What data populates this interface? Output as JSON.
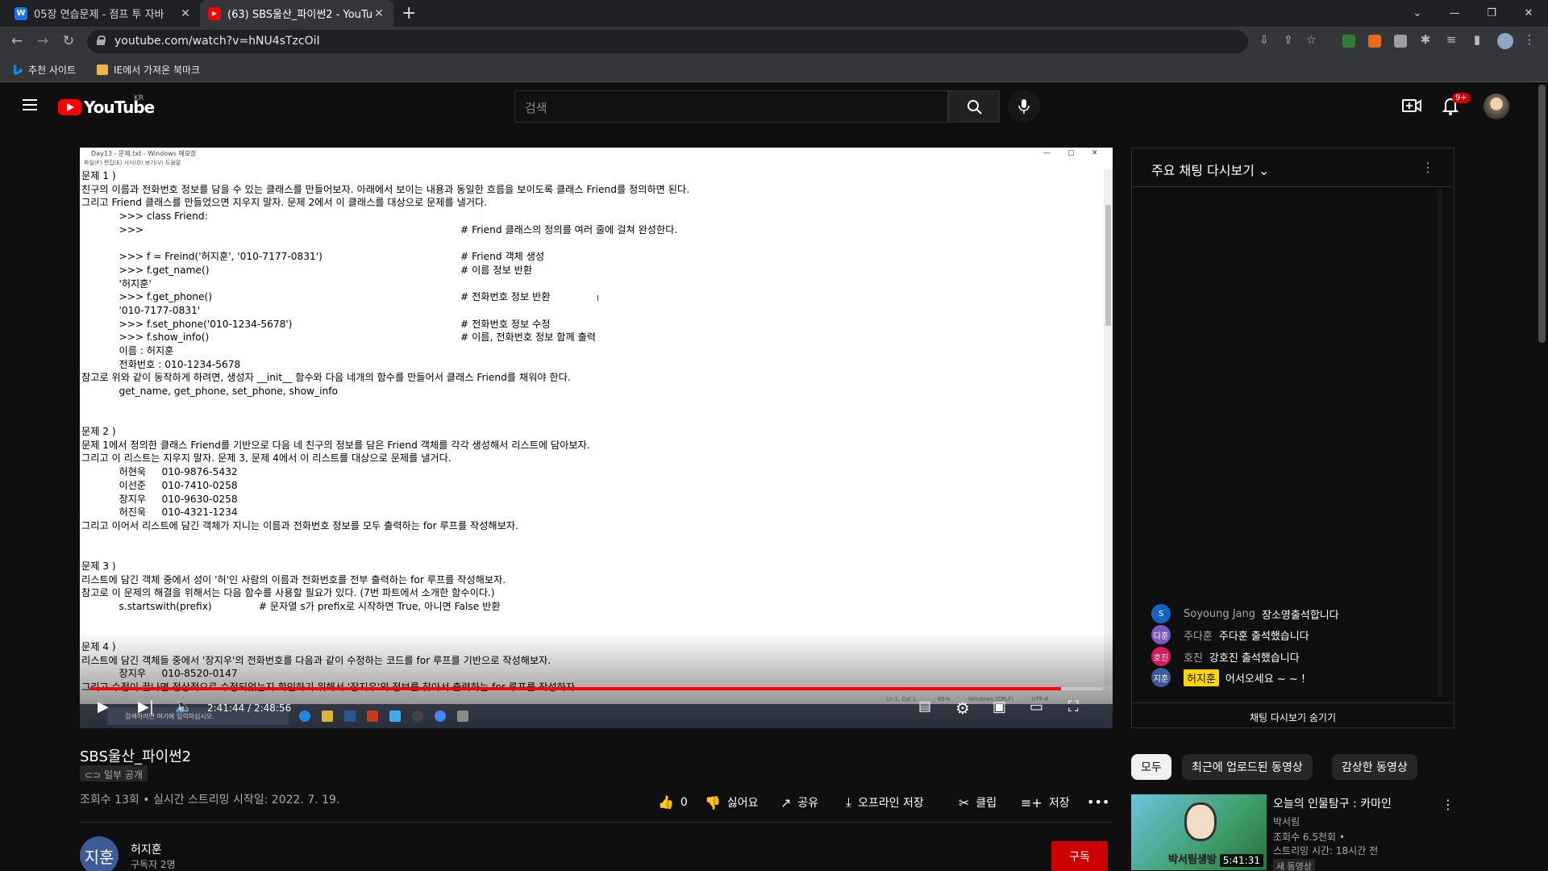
{
  "browser": {
    "tabs": [
      {
        "label": "05장 연습문제 - 점프 투 자바",
        "favicon": "W",
        "color": "#1a73e8"
      },
      {
        "label": "(63) SBS울산_파이썬2 - YouTube",
        "favicon": "▶",
        "color": "#ff0000"
      }
    ],
    "url": "youtube.com/watch?v=hNU4sTzcOiI",
    "bookmarks": [
      "추천 사이트",
      "IE에서 가져온 북마크"
    ]
  },
  "youtube": {
    "region": "KR",
    "search_placeholder": "검색",
    "notification_count": "9+"
  },
  "video": {
    "notepad_title": "Day13 - 문제.txt - Windows 메모장",
    "notepad_menu": "파일(F)   편집(E)   서식(O)   보기(V)   도움말",
    "status_bar": "Ln 1, Col 1            65%          Windows (CRLF)          UTF-8",
    "lines": [
      {
        "t": "문제 1 )",
        "c": ""
      },
      {
        "t": "친구의 이름과 전화번호 정보를 담을 수 있는 클래스를 만들어보자. 아래에서 보이는 내용과 동일한 흐름을 보이도록 클래스 Friend를 정의하면 된다.",
        "c": ""
      },
      {
        "t": "그리고 Friend 클래스를 만들었으면 지우지 말자. 문제 2에서 이 클래스를 대상으로 문제를 낼거다.",
        "c": ""
      },
      {
        "t": "            >>> class Friend:",
        "c": ""
      },
      {
        "t": "            >>>",
        "c": "# Friend 클래스의 정의를 여러 줄에 걸쳐 완성한다."
      },
      {
        "t": "",
        "c": ""
      },
      {
        "t": "            >>> f = Freind('허지훈', '010-7177-0831')",
        "c": "# Friend 객체 생성"
      },
      {
        "t": "            >>> f.get_name()",
        "c": "# 이름 정보 반환"
      },
      {
        "t": "            '허지훈'",
        "c": ""
      },
      {
        "t": "            >>> f.get_phone()",
        "c": "# 전화번호 정보 반환"
      },
      {
        "t": "            '010-7177-0831'",
        "c": ""
      },
      {
        "t": "            >>> f.set_phone('010-1234-5678')",
        "c": "# 전화번호 정보 수정"
      },
      {
        "t": "            >>> f.show_info()",
        "c": "# 이름, 전화번호 정보 함께 출력"
      },
      {
        "t": "            이름 : 허지훈",
        "c": ""
      },
      {
        "t": "            전화번호 : 010-1234-5678",
        "c": ""
      },
      {
        "t": "참고로 위와 같이 동작하게 하려면, 생성자 __init__ 함수와 다음 네개의 함수를 만들어서 클래스 Friend를 채워야 한다.",
        "c": ""
      },
      {
        "t": "            get_name, get_phone, set_phone, show_info",
        "c": ""
      },
      {
        "t": "",
        "c": ""
      },
      {
        "t": "",
        "c": ""
      },
      {
        "t": "문제 2 )",
        "c": ""
      },
      {
        "t": "문제 1에서 정의한 클래스 Friend를 기반으로 다음 네 친구의 정보를 담은 Friend 객체를 각각 생성해서 리스트에 담아보자.",
        "c": ""
      },
      {
        "t": "그리고 이 리스트는 지우지 말자. 문제 3, 문제 4에서 이 리스트를 대상으로 문제를 낼거다.",
        "c": ""
      },
      {
        "t": "            허현욱     010-9876-5432",
        "c": ""
      },
      {
        "t": "            이선준     010-7410-0258",
        "c": ""
      },
      {
        "t": "            장지우     010-9630-0258",
        "c": ""
      },
      {
        "t": "            허진욱     010-4321-1234",
        "c": ""
      },
      {
        "t": "그리고 이어서 리스트에 담긴 객체가 지니는 이름과 전화번호 정보를 모두 출력하는 for 루프를 작성해보자.",
        "c": ""
      },
      {
        "t": "",
        "c": ""
      },
      {
        "t": "",
        "c": ""
      },
      {
        "t": "문제 3 )",
        "c": ""
      },
      {
        "t": "리스트에 담긴 객체 중에서 성이 '허'인 사람의 이름과 전화번호를 전부 출력하는 for 루프를 작성해보자.",
        "c": ""
      },
      {
        "t": "참고로 이 문제의 해결을 위해서는 다음 함수를 사용할 필요가 있다. (7번 파트에서 소개한 함수이다.)",
        "c": ""
      },
      {
        "t": "            s.startswith(prefix)               # 문자열 s가 prefix로 시작하면 True, 아니면 False 반환",
        "c": ""
      },
      {
        "t": "",
        "c": ""
      },
      {
        "t": "",
        "c": ""
      },
      {
        "t": "문제 4 )",
        "c": ""
      },
      {
        "t": "리스트에 담긴 객체들 중에서 '장지우'의 전화번호를 다음과 같이 수정하는 코드를 for 루프를 기반으로 작성해보자.",
        "c": ""
      },
      {
        "t": "            장지우     010-8520-0147",
        "c": ""
      },
      {
        "t": "그리고 수정이 끝나면 정상적으로 수정되었는지 확인하기 위해서 '장지우'의 정보를 찾아서 출력하는 for 루프를 작성하자.",
        "c": ""
      }
    ],
    "taskbar_search": "검색하려면 여기에 입력하십시오.",
    "current_time": "2:41:44",
    "duration": "2:48:56",
    "progress": 0.9587,
    "title": "SBS울산_파이썬2",
    "visibility": "일부 공개",
    "meta": "조회수 13회 • 실시간 스트리밍 시작일: 2022. 7. 19.",
    "actions": {
      "like_count": "0",
      "dislike": "싫어요",
      "share": "공유",
      "offline": "오프라인 저장",
      "clip": "클립",
      "save": "저장"
    },
    "channel": {
      "avatar_text": "지훈",
      "name": "허지훈",
      "subs": "구독자 2명",
      "subscribe": "구독"
    }
  },
  "chat": {
    "title": "주요 채팅 다시보기",
    "messages": [
      {
        "avatar": "S",
        "avatar_color": "#1565c0",
        "author": "Soyoung Jang",
        "text": "장소영출석합니다",
        "owner": false
      },
      {
        "avatar": "다훈",
        "avatar_color": "#7e57c2",
        "author": "주다훈",
        "text": "주다훈 출석했습니다",
        "owner": false
      },
      {
        "avatar": "호진",
        "avatar_color": "#d81b60",
        "author": "호진",
        "text": "강호진 출석했습니다",
        "owner": false
      },
      {
        "avatar": "지훈",
        "avatar_color": "#3d5a99",
        "author": "허지훈",
        "text": "어서오세요 ~ ~ !",
        "owner": true
      }
    ],
    "hide_label": "채팅 다시보기 숨기기"
  },
  "sidebar": {
    "chips": [
      "모두",
      "최근에 업로드된 동영상",
      "감상한 동영상"
    ],
    "recommended": {
      "title": "오늘의 인물탐구 : 카마인",
      "channel": "박서림",
      "views": "조회수 6.5천회 •",
      "stream_time": "스트리밍 시간: 18시간 전",
      "badge": "새 동영상",
      "duration": "5:41:31",
      "thumb_text": "박서림생방"
    }
  }
}
